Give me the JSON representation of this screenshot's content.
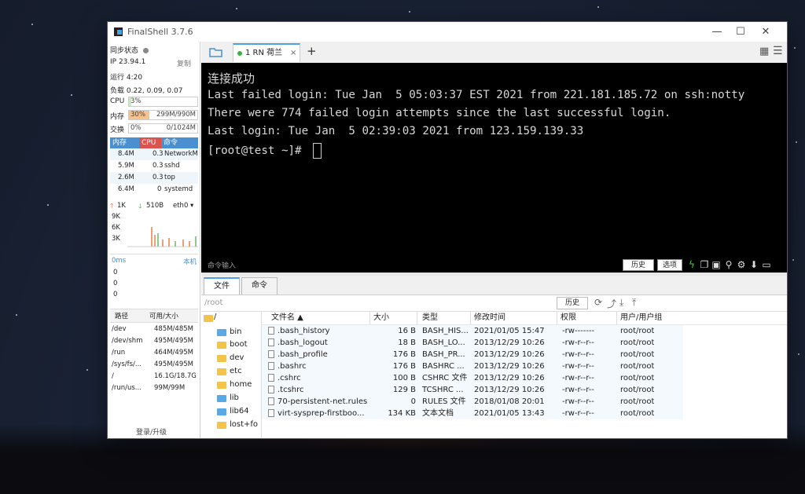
{
  "app": {
    "title": "FinalShell 3.7.6"
  },
  "status": {
    "sync_label": "同步状态",
    "ip": "IP 23.94.1",
    "copy": "复制",
    "uptime": "运行 4:20",
    "load": "负载 0.22, 0.09, 0.07",
    "cpu_label": "CPU",
    "cpu_pct": "3%",
    "cpu_fraction": 0.03,
    "mem_label": "内存",
    "mem_pct": "30%",
    "mem_fraction": 0.3,
    "mem_detail": "299M/990M",
    "swap_label": "交换",
    "swap_pct": "0%",
    "swap_detail": "0/1024M"
  },
  "processes": {
    "headers": [
      "内存",
      "CPU",
      "命令"
    ],
    "rows": [
      {
        "mem": "8.4M",
        "cpu": "0.3",
        "cmd": "NetworkM"
      },
      {
        "mem": "5.9M",
        "cpu": "0.3",
        "cmd": "sshd"
      },
      {
        "mem": "2.6M",
        "cpu": "0.3",
        "cmd": "top"
      },
      {
        "mem": "6.4M",
        "cpu": "0",
        "cmd": "systemd"
      }
    ]
  },
  "network": {
    "up": "1K",
    "down": "510B",
    "iface": "eth0",
    "scale": [
      "9K",
      "6K",
      "3K"
    ]
  },
  "ping": {
    "latency": "0ms",
    "host": "本机",
    "values": [
      "0",
      "0",
      "0"
    ]
  },
  "disks": {
    "headers": [
      "路径",
      "可用/大小"
    ],
    "rows": [
      {
        "path": "/dev",
        "size": "485M/485M"
      },
      {
        "path": "/dev/shm",
        "size": "495M/495M"
      },
      {
        "path": "/run",
        "size": "464M/495M"
      },
      {
        "path": "/sys/fs/...",
        "size": "495M/495M"
      },
      {
        "path": "/",
        "size": "16.1G/18.7G"
      },
      {
        "path": "/run/us...",
        "size": "99M/99M"
      }
    ]
  },
  "login_upgrade": "登录/升级",
  "session": {
    "tab_label": "1 RN 荷兰",
    "close": "×",
    "add": "+"
  },
  "terminal": {
    "lines": [
      "连接成功",
      "Last failed login: Tue Jan  5 05:03:37 EST 2021 from 221.181.185.72 on ssh:notty",
      "There were 774 failed login attempts since the last successful login.",
      "Last login: Tue Jan  5 02:39:03 2021 from 123.159.139.33",
      "[root@test ~]# "
    ],
    "cmd_input_label": "命令输入",
    "history_btn": "历史",
    "options_btn": "选项"
  },
  "file_tabs": [
    "文件",
    "命令"
  ],
  "path": {
    "value": "/root",
    "history_btn": "历史"
  },
  "tree": {
    "root": "/",
    "items": [
      "bin",
      "boot",
      "dev",
      "etc",
      "home",
      "lib",
      "lib64",
      "lost+fo"
    ]
  },
  "files": {
    "headers": [
      "文件名 ▲",
      "大小",
      "类型",
      "修改时间",
      "权限",
      "用户/用户组"
    ],
    "rows": [
      {
        "name": ".bash_history",
        "size": "16 B",
        "type": "BASH_HIS...",
        "mtime": "2021/01/05 15:47",
        "perm": "-rw-------",
        "owner": "root/root"
      },
      {
        "name": ".bash_logout",
        "size": "18 B",
        "type": "BASH_LO...",
        "mtime": "2013/12/29 10:26",
        "perm": "-rw-r--r--",
        "owner": "root/root"
      },
      {
        "name": ".bash_profile",
        "size": "176 B",
        "type": "BASH_PR...",
        "mtime": "2013/12/29 10:26",
        "perm": "-rw-r--r--",
        "owner": "root/root"
      },
      {
        "name": ".bashrc",
        "size": "176 B",
        "type": "BASHRC ...",
        "mtime": "2013/12/29 10:26",
        "perm": "-rw-r--r--",
        "owner": "root/root"
      },
      {
        "name": ".cshrc",
        "size": "100 B",
        "type": "CSHRC 文件",
        "mtime": "2013/12/29 10:26",
        "perm": "-rw-r--r--",
        "owner": "root/root"
      },
      {
        "name": ".tcshrc",
        "size": "129 B",
        "type": "TCSHRC ...",
        "mtime": "2013/12/29 10:26",
        "perm": "-rw-r--r--",
        "owner": "root/root"
      },
      {
        "name": "70-persistent-net.rules",
        "size": "0",
        "type": "RULES 文件",
        "mtime": "2018/01/08 20:01",
        "perm": "-rw-r--r--",
        "owner": "root/root"
      },
      {
        "name": "virt-sysprep-firstboo...",
        "size": "134 KB",
        "type": "文本文档",
        "mtime": "2021/01/05 13:43",
        "perm": "-rw-r--r--",
        "owner": "root/root"
      }
    ]
  },
  "colors": {
    "accent": "#4aa3df",
    "proc_header_mem": "#4a8fd0",
    "proc_header_cpu": "#d9534f",
    "terminal_bg": "#000000",
    "up_arrow": "#e0612f",
    "down_arrow": "#3a9a3a"
  }
}
